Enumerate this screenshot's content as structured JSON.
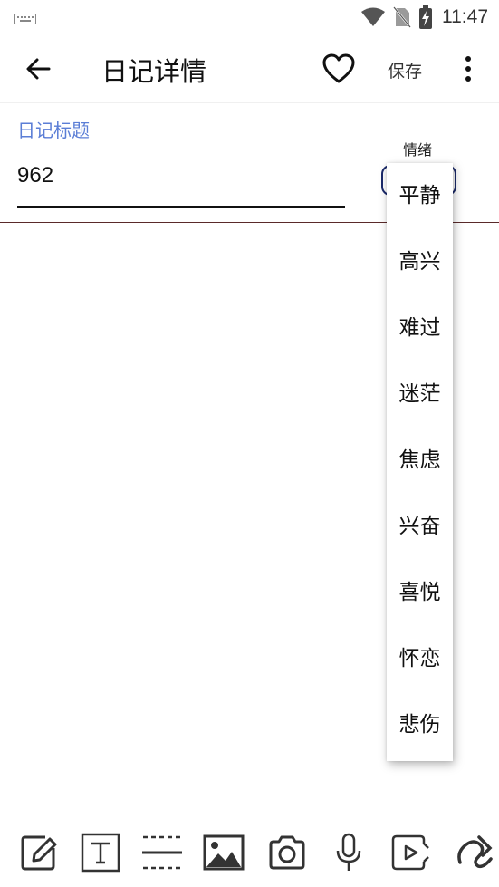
{
  "status_bar": {
    "time": "11:47",
    "icons": [
      "keyboard-icon",
      "wifi-icon",
      "no-sim-icon",
      "battery-charging-icon"
    ]
  },
  "app_bar": {
    "title": "日记详情",
    "save_label": "保存",
    "icons": [
      "back-arrow-icon",
      "heart-icon",
      "more-vert-icon"
    ]
  },
  "title_field": {
    "label": "日记标题",
    "value": "962"
  },
  "mood": {
    "label": "情绪",
    "options": [
      "平静",
      "高兴",
      "难过",
      "迷茫",
      "焦虑",
      "兴奋",
      "喜悦",
      "怀恋",
      "悲伤"
    ]
  },
  "toolbar": {
    "icons": [
      "edit-icon",
      "text-icon",
      "divider-icon",
      "image-icon",
      "camera-icon",
      "mic-icon",
      "video-icon",
      "draw-icon"
    ]
  },
  "colors": {
    "accent": "#5b7ed6",
    "text": "#111111",
    "select_border": "#1b2a6b"
  }
}
